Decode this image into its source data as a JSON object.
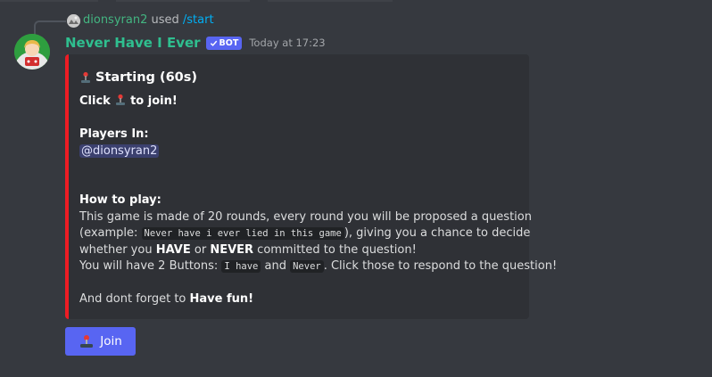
{
  "reply": {
    "username": "dionsyran2",
    "used_text": "used",
    "command": "/start"
  },
  "message": {
    "author": "Never Have I Ever",
    "bot_tag": "BOT",
    "timestamp": "Today at 17:23"
  },
  "embed": {
    "accent_color": "#ed1c24",
    "title": "Starting (60s)",
    "click_prefix": "Click",
    "click_suffix": "to join!",
    "players_heading": "Players In:",
    "player_mention": "@dionsyran2",
    "how_to_heading": "How to play:",
    "line1": "This game is made of 20 rounds, every round you will be proposed a question",
    "line2_prefix": "(example:",
    "line2_code": "Never have i ever lied in this game",
    "line2_suffix": "), giving you a chance to decide",
    "line3_prefix": "whether you",
    "line3_have": "HAVE",
    "line3_or": "or",
    "line3_never": "NEVER",
    "line3_suffix": "committed to the question!",
    "line4_prefix": "You will have 2 Buttons:",
    "line4_code1": "I have",
    "line4_and": "and",
    "line4_code2": "Never",
    "line4_suffix": ". Click those to respond to the question!",
    "footer_prefix": "And dont forget to",
    "footer_bold": "Have fun!"
  },
  "button": {
    "label": "Join",
    "icon": "joystick-icon",
    "color": "#5865f2"
  }
}
